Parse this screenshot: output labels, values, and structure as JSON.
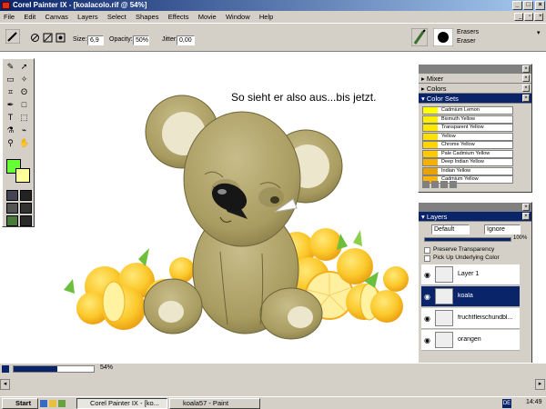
{
  "app": {
    "title": "Corel Painter IX - [koalacolo.rif @ 54%]"
  },
  "menu": [
    "File",
    "Edit",
    "Canvas",
    "Layers",
    "Select",
    "Shapes",
    "Effects",
    "Movie",
    "Window",
    "Help"
  ],
  "propbar": {
    "size_label": "Size:",
    "size_value": "6,9",
    "opacity_label": "Opacity:",
    "opacity_value": "50%",
    "jitter_label": "Jitter:",
    "jitter_value": "0,00",
    "brush_category": "Erasers",
    "brush_variant": "Eraser"
  },
  "canvas": {
    "caption": "So sieht er also aus...bis jetzt."
  },
  "colors": {
    "primary": "#66ff33",
    "secondary": "#ffff99",
    "accent": "#0a246a"
  },
  "palette": {
    "mixer_label": "Mixer",
    "colors_label": "Colors",
    "color_sets_label": "Color Sets",
    "color_sets": [
      {
        "name": "Cadmium Lemon",
        "color": "#ffff00"
      },
      {
        "name": "Bismuth Yellow",
        "color": "#fcf000"
      },
      {
        "name": "Transparent Yellow",
        "color": "#ffe800"
      },
      {
        "name": "Yellow",
        "color": "#ffe000"
      },
      {
        "name": "Chrome Yellow",
        "color": "#ffd400"
      },
      {
        "name": "Pale Cadmium Yellow",
        "color": "#ffc800"
      },
      {
        "name": "Deep Indian Yellow",
        "color": "#f5b000"
      },
      {
        "name": "Indian Yellow",
        "color": "#eaa200"
      },
      {
        "name": "Cadmium Yellow",
        "color": "#ffb400"
      }
    ]
  },
  "layers": {
    "panel_label": "Layers",
    "composite_method": "Default",
    "composite_depth": "Ignore",
    "opacity_value": "100%",
    "preserve_transparency": "Preserve Transparency",
    "pick_up_color": "Pick Up Underlying Color",
    "items": [
      {
        "name": "Layer 1",
        "selected": false
      },
      {
        "name": "koala",
        "selected": true
      },
      {
        "name": "fruchtfleischundbl...",
        "selected": false
      },
      {
        "name": "orangen",
        "selected": false
      }
    ]
  },
  "status": {
    "zoom": "54%"
  },
  "taskbar": {
    "start": "Start",
    "tasks": [
      "Corel Painter IX - [ko...",
      "koala57 - Paint"
    ],
    "lang": "DE",
    "clock": "14:49"
  }
}
